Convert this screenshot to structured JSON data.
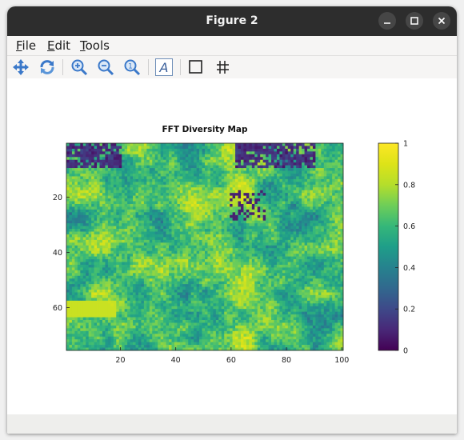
{
  "window": {
    "title": "Figure 2"
  },
  "menu": {
    "items": [
      "File",
      "Edit",
      "Tools"
    ]
  },
  "toolbar": {
    "tools": [
      "pan-icon",
      "rotate-icon",
      "zoom-in-icon",
      "zoom-out-icon",
      "zoom-reset-icon",
      "text-insert-icon",
      "axes-box-icon",
      "grid-icon"
    ]
  },
  "colors": {
    "titlebar": "#2d2d2d",
    "viridis_low": "#440154",
    "viridis_mid": "#21918c",
    "viridis_high": "#fde725"
  },
  "chart_data": {
    "type": "heatmap",
    "title": "FFT Diversity Map",
    "xlabel": "",
    "ylabel": "",
    "xlim": [
      0.5,
      100.5
    ],
    "ylim": [
      0.5,
      75.5
    ],
    "xticks": [
      20,
      40,
      60,
      80,
      100
    ],
    "yticks": [
      20,
      40,
      60
    ],
    "colorbar": {
      "ticks": [
        "0",
        "0.2",
        "0.4",
        "0.6",
        "0.8",
        "1"
      ],
      "range": [
        0,
        1
      ],
      "colormap": "viridis"
    },
    "grid": false
  }
}
